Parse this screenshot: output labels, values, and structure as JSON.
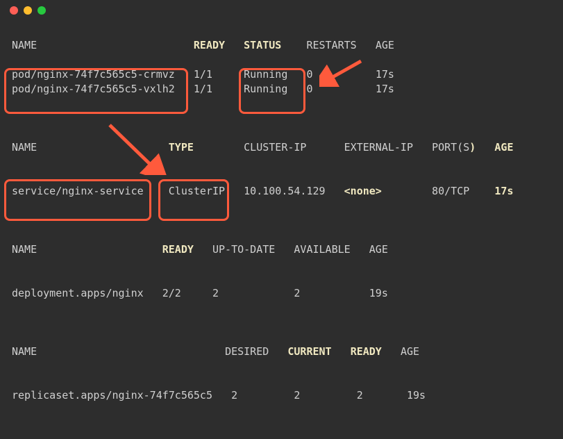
{
  "pods": {
    "headers": {
      "name": "NAME",
      "ready": "READY",
      "status": "STATUS",
      "restarts": "RESTARTS",
      "age": "AGE"
    },
    "rows": [
      {
        "name": "pod/nginx-74f7c565c5-crmvz",
        "ready": "1/1",
        "status": "Running",
        "restarts": "0",
        "age": "17s"
      },
      {
        "name": "pod/nginx-74f7c565c5-vxlh2",
        "ready": "1/1",
        "status": "Running",
        "restarts": "0",
        "age": "17s"
      }
    ]
  },
  "services": {
    "headers": {
      "name": "NAME",
      "type": "TYPE",
      "clusterip": "CLUSTER-IP",
      "externalip": "EXTERNAL-IP",
      "ports": "PORT(S)",
      "age": "AGE"
    },
    "rows": [
      {
        "name": "service/nginx-service",
        "type": "ClusterIP",
        "clusterip": "10.100.54.129",
        "externalip": "<none>",
        "ports": "80/TCP",
        "age": "17s"
      }
    ]
  },
  "deployments": {
    "headers": {
      "name": "NAME",
      "ready": "READY",
      "uptodate": "UP-TO-DATE",
      "available": "AVAILABLE",
      "age": "AGE"
    },
    "rows": [
      {
        "name": "deployment.apps/nginx",
        "ready": "2/2",
        "uptodate": "2",
        "available": "2",
        "age": "19s"
      }
    ]
  },
  "replicasets": {
    "headers": {
      "name": "NAME",
      "desired": "DESIRED",
      "current": "CURRENT",
      "ready": "READY",
      "age": "AGE"
    },
    "rows": [
      {
        "name": "replicaset.apps/nginx-74f7c565c5",
        "desired": "2",
        "current": "2",
        "ready": "2",
        "age": "19s"
      }
    ]
  }
}
